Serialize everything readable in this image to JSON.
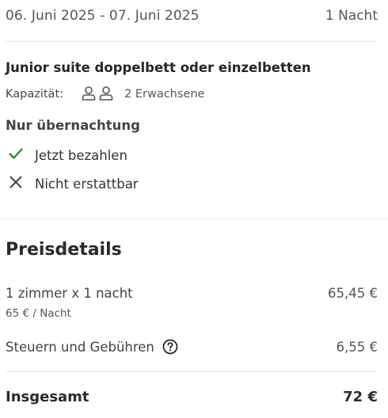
{
  "stay": {
    "dates": "06. Juni 2025 - 07. Juni 2025",
    "nights": "1 Nacht"
  },
  "room": {
    "name": "Junior suite doppelbett oder einzelbetten",
    "capacity_label": "Kapazität:",
    "capacity_value": "2 Erwachsene",
    "capacity_icons": [
      "person-icon",
      "person-icon"
    ],
    "board": "Nur übernachtung",
    "features": [
      {
        "label": "Jetzt bezahlen",
        "icon": "check-icon",
        "color": "#2e8b3d"
      },
      {
        "label": "Nicht erstattbar",
        "icon": "close-icon",
        "color": "#444444"
      }
    ]
  },
  "price": {
    "title": "Preisdetails",
    "rooms_label": "1 zimmer x 1 nacht",
    "rooms_value": "65,45 €",
    "per_night": "65 € / Nacht",
    "taxes_label": "Steuern und Gebühren",
    "taxes_icon": "help-circle-icon",
    "taxes_value": "6,55 €",
    "total_label": "Insgesamt",
    "total_value": "72 €"
  }
}
